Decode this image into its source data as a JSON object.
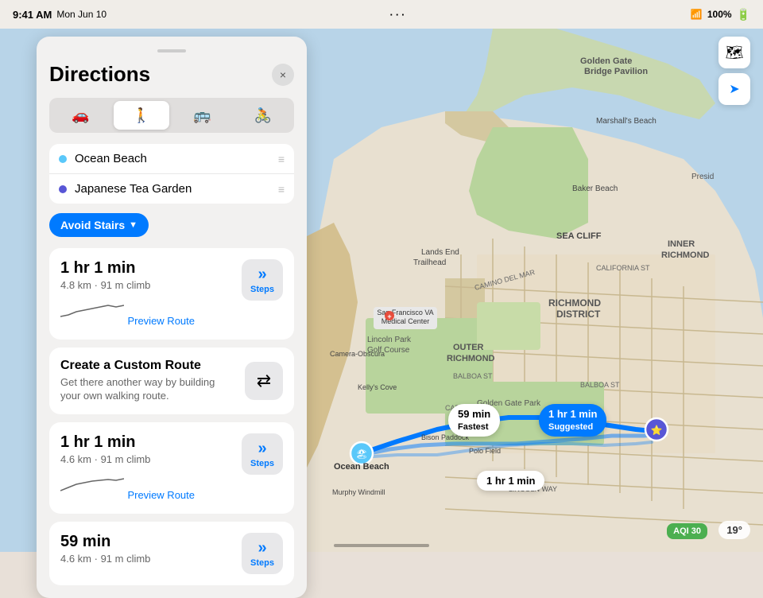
{
  "statusBar": {
    "time": "9:41 AM",
    "date": "Mon Jun 10",
    "dots": "···",
    "battery": "100%",
    "wifi": "WiFi"
  },
  "panel": {
    "title": "Directions",
    "closeLabel": "×",
    "dragHandle": "",
    "transportModes": [
      {
        "id": "drive",
        "icon": "🚗",
        "label": "Drive",
        "active": false
      },
      {
        "id": "walk",
        "icon": "🚶",
        "label": "Walk",
        "active": true
      },
      {
        "id": "transit",
        "icon": "🚌",
        "label": "Transit",
        "active": false
      },
      {
        "id": "cycle",
        "icon": "🚴",
        "label": "Cycle",
        "active": false
      }
    ],
    "origin": {
      "label": "Ocean Beach",
      "dotClass": "origin"
    },
    "destination": {
      "label": "Japanese Tea Garden",
      "dotClass": "destination"
    },
    "avoidButton": "Avoid Stairs",
    "routes": [
      {
        "time": "1 hr 1 min",
        "details": "4.8 km · 91 m climb",
        "previewLink": "Preview Route",
        "stepsLabel": "Steps"
      },
      {
        "customTitle": "Create a Custom Route",
        "customDesc": "Get there another way by building your own walking route."
      },
      {
        "time": "1 hr 1 min",
        "details": "4.6 km · 91 m climb",
        "previewLink": "Preview Route",
        "stepsLabel": "Steps"
      },
      {
        "time": "59 min",
        "details": "4.6 km · 91 m climb",
        "stepsLabel": "Steps"
      }
    ]
  },
  "mapButtons": [
    {
      "id": "map-type",
      "icon": "🗺"
    },
    {
      "id": "location",
      "icon": "➤"
    }
  ],
  "mapLabels": [
    {
      "text": "1 hr 1 min\nSuggested",
      "type": "suggested"
    },
    {
      "text": "59 min\nFastest",
      "type": "fastest"
    },
    {
      "text": "1 hr 1 min",
      "type": "plain"
    }
  ],
  "mapPlaces": [
    {
      "name": "Ocean Beach",
      "color": "#5ac8fa",
      "icon": "🏖"
    },
    {
      "name": "Japanese Tea Garden",
      "color": "#5856d6",
      "icon": "⭐"
    }
  ],
  "weather": {
    "temp": "19°",
    "aqi": "AQI 30"
  }
}
